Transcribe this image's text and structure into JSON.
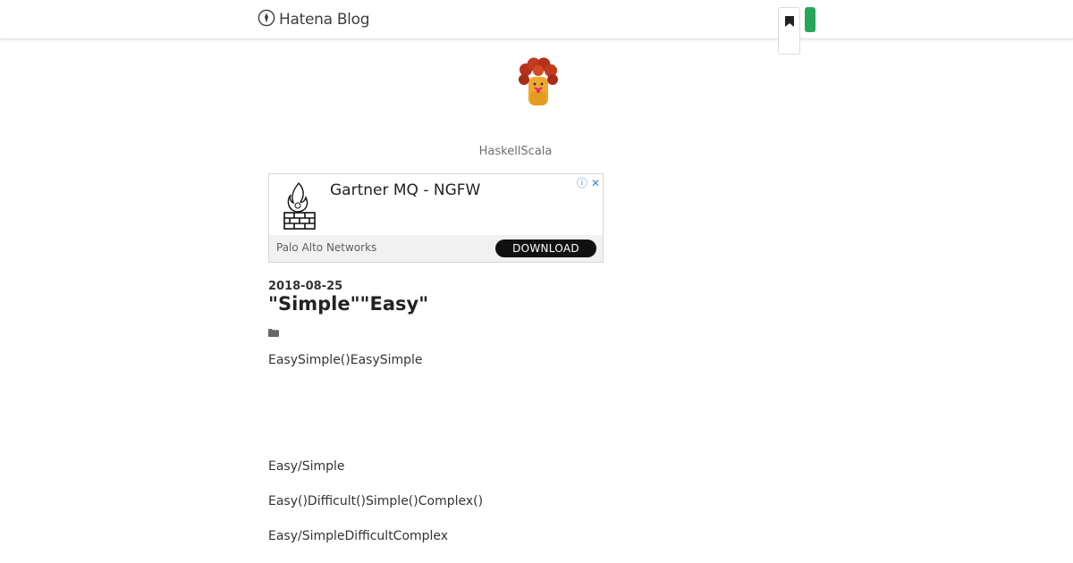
{
  "header": {
    "logo_text": "Hatena Blog",
    "logo_icon": "hatena-pen-icon",
    "bookmark_icon": "bookmark-icon",
    "accent_color": "#26a65b"
  },
  "blog": {
    "title": "HaskellScala",
    "avatar_icon": "blog-avatar"
  },
  "ad": {
    "headline": "Gartner MQ - NGFW",
    "advertiser": "Palo Alto Networks",
    "cta_label": "DOWNLOAD",
    "info_icon": "ⓘ",
    "close_icon": "✕",
    "logo_icon": "firewall-flame-icon"
  },
  "entry": {
    "date": "2018-08-25",
    "title": "\"Simple\"\"Easy\"",
    "category_icon": "folder-icon",
    "paragraphs": [
      "EasySimple()EasySimple",
      "Easy/Simple",
      "Easy()Difficult()Simple()Complex()",
      "Easy/SimpleDifficultComplex"
    ]
  }
}
